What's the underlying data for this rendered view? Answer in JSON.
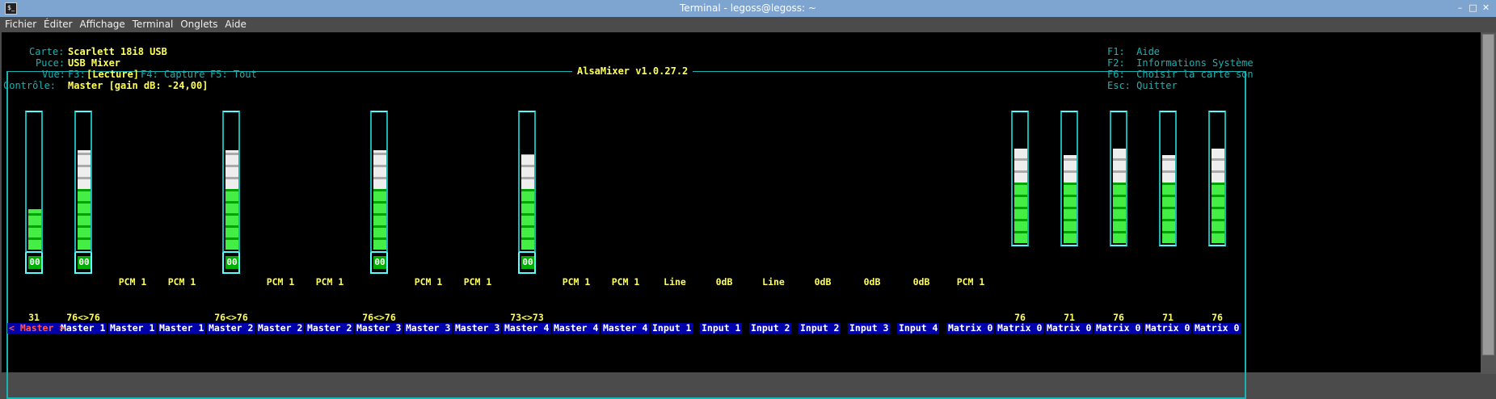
{
  "window": {
    "title": "Terminal - legoss@legoss: ~",
    "min": "–",
    "max": "□",
    "close": "✕",
    "icon_label": "$_"
  },
  "menu": [
    "Fichier",
    "Éditer",
    "Affichage",
    "Terminal",
    "Onglets",
    "Aide"
  ],
  "mixer": {
    "title": "AlsaMixer v1.0.27.2",
    "card_label": "Carte:",
    "card": "Scarlett 18i8 USB",
    "chip_label": "Puce:",
    "chip": "USB Mixer",
    "view_label": "Vue:",
    "view_f3": "F3:",
    "view_lecture": "[Lecture]",
    "view_f4": "F4: Capture",
    "view_f5": "F5: Tout",
    "control_label": "Contrôle:",
    "control": "Master [gain dB: -24,00]",
    "help": [
      "F1:  Aide",
      "F2:  Informations Système",
      "F6:  Choisir la carte son",
      "Esc: Quitter"
    ],
    "channels": [
      {
        "label": "Master",
        "selected": true,
        "value": "31",
        "level": 31,
        "mute": "00"
      },
      {
        "label": "Master 1",
        "value": "76<>76",
        "level": 76,
        "mute": "00"
      },
      {
        "label": "Master 1",
        "enum": "PCM 1"
      },
      {
        "label": "Master 1",
        "enum": "PCM 1"
      },
      {
        "label": "Master 2",
        "value": "76<>76",
        "level": 76,
        "mute": "00"
      },
      {
        "label": "Master 2",
        "enum": "PCM 1"
      },
      {
        "label": "Master 2",
        "enum": "PCM 1"
      },
      {
        "label": "Master 3",
        "value": "76<>76",
        "level": 76,
        "mute": "00"
      },
      {
        "label": "Master 3",
        "enum": "PCM 1"
      },
      {
        "label": "Master 3",
        "enum": "PCM 1"
      },
      {
        "label": "Master 4",
        "value": "73<>73",
        "level": 73,
        "mute": "00"
      },
      {
        "label": "Master 4",
        "enum": "PCM 1"
      },
      {
        "label": "Master 4",
        "enum": "PCM 1"
      },
      {
        "label": "Input 1",
        "enum": "Line"
      },
      {
        "label": "Input 1",
        "enum": "0dB"
      },
      {
        "label": "Input 2",
        "enum": "Line"
      },
      {
        "label": "Input 2",
        "enum": "0dB"
      },
      {
        "label": "Input 3",
        "enum": "0dB"
      },
      {
        "label": "Input 4",
        "enum": "0dB"
      },
      {
        "label": "Matrix 0",
        "enum": "PCM 1"
      },
      {
        "label": "Matrix 0",
        "value": "76",
        "level": 76
      },
      {
        "label": "Matrix 0",
        "value": "71",
        "level": 71
      },
      {
        "label": "Matrix 0",
        "value": "76",
        "level": 76
      },
      {
        "label": "Matrix 0",
        "value": "71",
        "level": 71
      },
      {
        "label": "Matrix 0",
        "value": "76",
        "level": 76
      }
    ]
  }
}
